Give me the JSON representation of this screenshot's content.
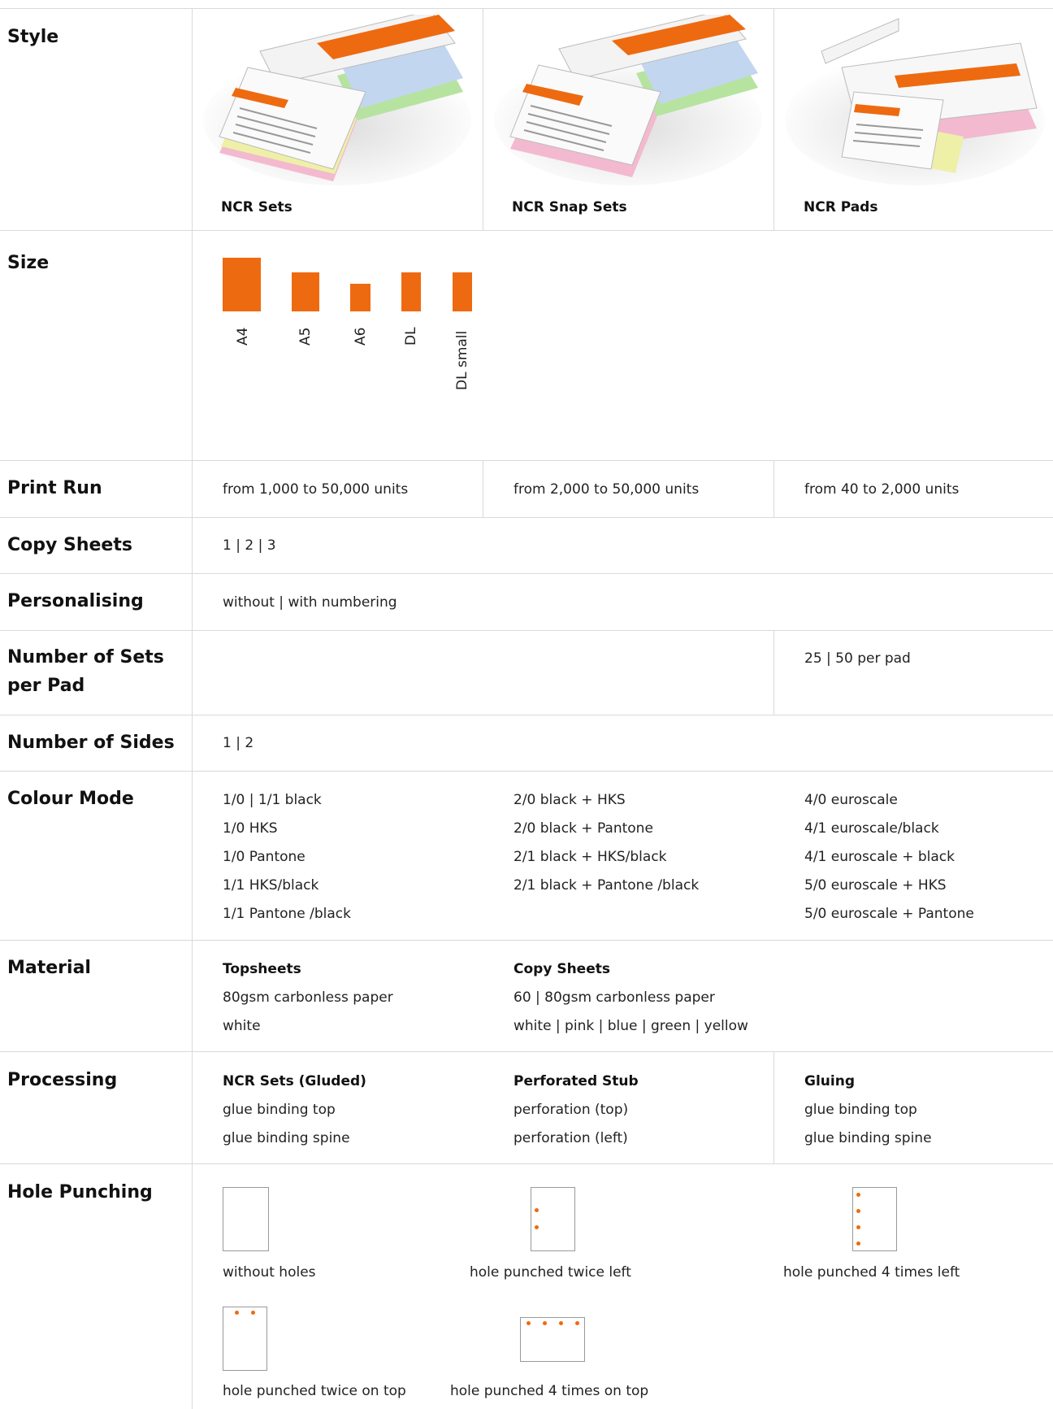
{
  "rows": {
    "style": {
      "label": "Style",
      "items": [
        {
          "label": "NCR Sets"
        },
        {
          "label": "NCR Snap Sets"
        },
        {
          "label": "NCR Pads"
        }
      ]
    },
    "size": {
      "label": "Size",
      "items": [
        "A4",
        "A5",
        "A6",
        "DL",
        "DL small"
      ]
    },
    "print_run": {
      "label": "Print Run",
      "values": [
        "from 1,000 to 50,000 units",
        "from 2,000 to 50,000 units",
        "from 40 to 2,000 units"
      ]
    },
    "copy_sheets": {
      "label": "Copy Sheets",
      "value": "1 | 2 | 3"
    },
    "personalising": {
      "label": "Personalising",
      "value": "without | with numbering"
    },
    "sets_per_pad": {
      "label_line1": "Number of Sets",
      "label_line2": "per Pad",
      "value": "25 | 50 per pad"
    },
    "sides": {
      "label": "Number of Sides",
      "value": "1 | 2"
    },
    "colour_mode": {
      "label": "Colour Mode",
      "col1": [
        "1/0 | 1/1 black",
        "1/0 HKS",
        "1/0 Pantone",
        "1/1 HKS/black",
        "1/1 Pantone /black"
      ],
      "col2": [
        "2/0 black + HKS",
        "2/0 black + Pantone",
        "2/1 black + HKS/black",
        "2/1 black + Pantone /black"
      ],
      "col3": [
        "4/0 euroscale",
        "4/1 euroscale/black",
        "4/1 euroscale + black",
        "5/0 euroscale + HKS",
        "5/0 euroscale + Pantone"
      ]
    },
    "material": {
      "label": "Material",
      "topsheets": {
        "title": "Topsheets",
        "lines": [
          "80gsm carbonless paper",
          "white"
        ]
      },
      "copy": {
        "title": "Copy Sheets",
        "lines": [
          "60 | 80gsm carbonless paper",
          "white | pink | blue | green | yellow"
        ]
      }
    },
    "processing": {
      "label": "Processing",
      "col1": {
        "title": "NCR Sets (Gluded)",
        "lines": [
          "glue binding top",
          "glue binding spine"
        ]
      },
      "col2": {
        "title": "Perforated Stub",
        "lines": [
          "perforation (top)",
          "perforation (left)"
        ]
      },
      "col3": {
        "title": "Gluing",
        "lines": [
          "glue binding top",
          "glue binding spine"
        ]
      }
    },
    "hole_punching": {
      "label": "Hole Punching",
      "options": [
        "without holes",
        "hole punched twice left",
        "hole punched 4 times left",
        "hole punched twice on top",
        "hole punched 4 times on top"
      ]
    }
  },
  "colors": {
    "accent": "#ee6a10",
    "divider": "#d9d9d9"
  }
}
